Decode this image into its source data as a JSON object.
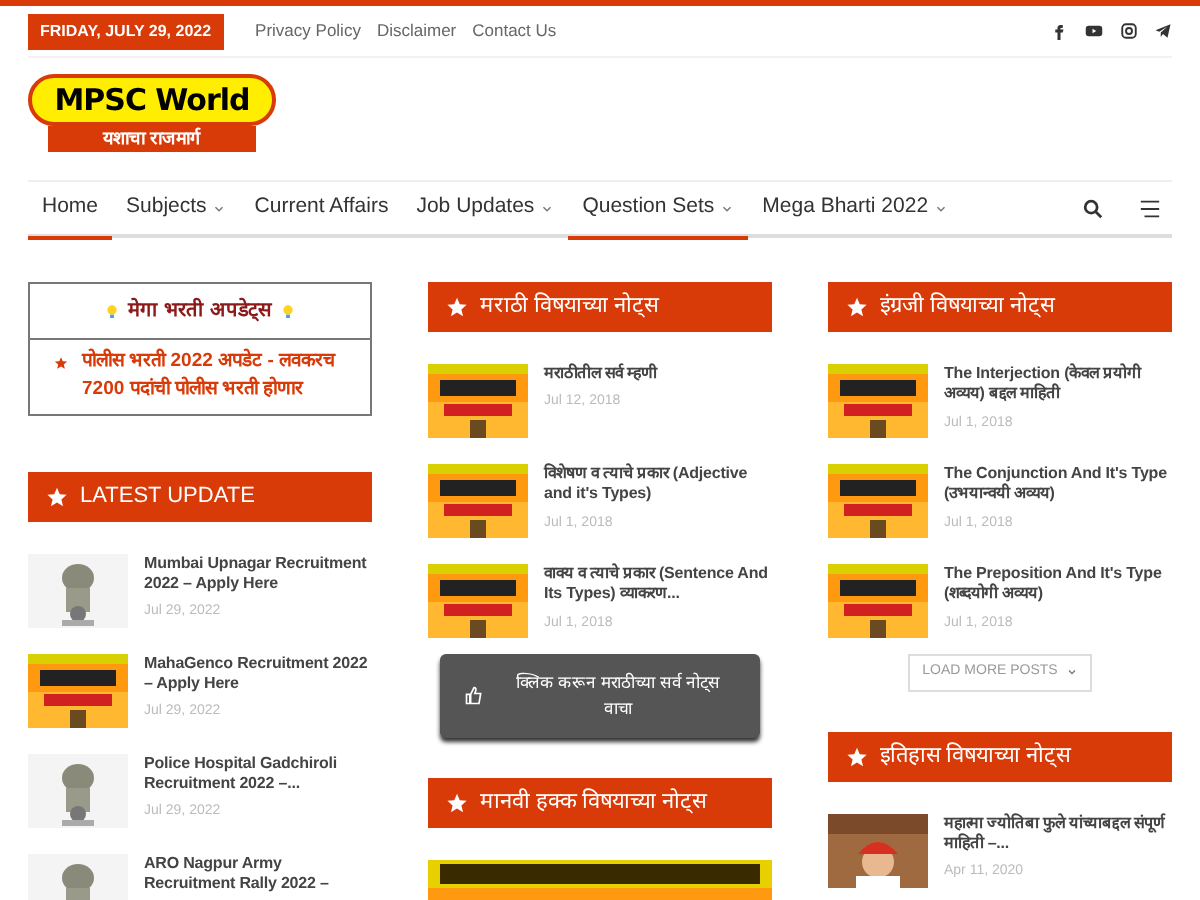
{
  "top_bar": {
    "date": "FRIDAY, JULY 29, 2022",
    "links": [
      "Privacy Policy",
      "Disclaimer",
      "Contact Us"
    ]
  },
  "logo": {
    "title": "MPSC World",
    "tagline": "यशाचा राजमार्ग"
  },
  "nav": [
    {
      "label": "Home",
      "selected": true,
      "dropdown": false
    },
    {
      "label": "Subjects",
      "selected": false,
      "dropdown": true
    },
    {
      "label": "Current Affairs",
      "selected": false,
      "dropdown": false
    },
    {
      "label": "Job Updates",
      "selected": false,
      "dropdown": true
    },
    {
      "label": "Question Sets",
      "selected": true,
      "dropdown": true
    },
    {
      "label": "Mega Bharti 2022",
      "selected": false,
      "dropdown": true
    }
  ],
  "columns": [
    {
      "widgets": [
        {
          "kind": "mega",
          "title": "मेगा भरती अपडेट्स",
          "items": [
            "पोलीस भरती 2022 अपडेट - लवकरच 7200 पदांची पोलीस भरती होणार"
          ]
        },
        {
          "kind": "posts",
          "title": "LATEST UPDATE",
          "posts": [
            {
              "title": "Mumbai Upnagar Recruitment 2022 – Apply Here",
              "date": "Jul 29, 2022"
            },
            {
              "title": "MahaGenco Recruitment 2022 – Apply Here",
              "date": "Jul 29, 2022"
            },
            {
              "title": "Police Hospital Gadchiroli Recruitment 2022 –...",
              "date": "Jul 29, 2022"
            },
            {
              "title": "ARO Nagpur Army Recruitment Rally 2022 –"
            }
          ]
        }
      ]
    },
    {
      "widgets": [
        {
          "kind": "posts",
          "title": "मराठी विषयाच्या नोट्स",
          "posts": [
            {
              "title": "मराठीतील सर्व म्हणी",
              "date": "Jul 12, 2018"
            },
            {
              "title": "विशेषण व त्याचे प्रकार (Adjective and it's Types)",
              "date": "Jul 1, 2018"
            },
            {
              "title": "वाक्य व त्याचे प्रकार (Sentence And Its Types) व्याकरण...",
              "date": "Jul 1, 2018"
            }
          ],
          "button": {
            "kind": "dark",
            "label": "क्लिक करून मराठीच्या सर्व नोट्स वाचा"
          }
        },
        {
          "kind": "banner",
          "title": "मानवी हक्क विषयाच्या नोट्स"
        }
      ]
    },
    {
      "widgets": [
        {
          "kind": "posts",
          "title": "इंग्रजी विषयाच्या नोट्स",
          "posts": [
            {
              "title": "The Interjection (केवल प्रयोगी अव्यय) बद्दल माहिती",
              "date": "Jul 1, 2018"
            },
            {
              "title": "The Conjunction And It's Type (उभयान्वयी अव्यय)",
              "date": "Jul 1, 2018"
            },
            {
              "title": "The Preposition And It's Type (शब्दयोगी अव्यय)",
              "date": "Jul 1, 2018"
            }
          ],
          "button": {
            "kind": "outline",
            "label": "LOAD MORE POSTS"
          }
        },
        {
          "kind": "posts",
          "title": "इतिहास विषयाच्या नोट्स",
          "posts": [
            {
              "title": "महात्मा ज्योतिबा फुले यांच्याबद्दल संपूर्ण माहिती –...",
              "date": "Apr 11, 2020"
            }
          ]
        }
      ]
    }
  ]
}
